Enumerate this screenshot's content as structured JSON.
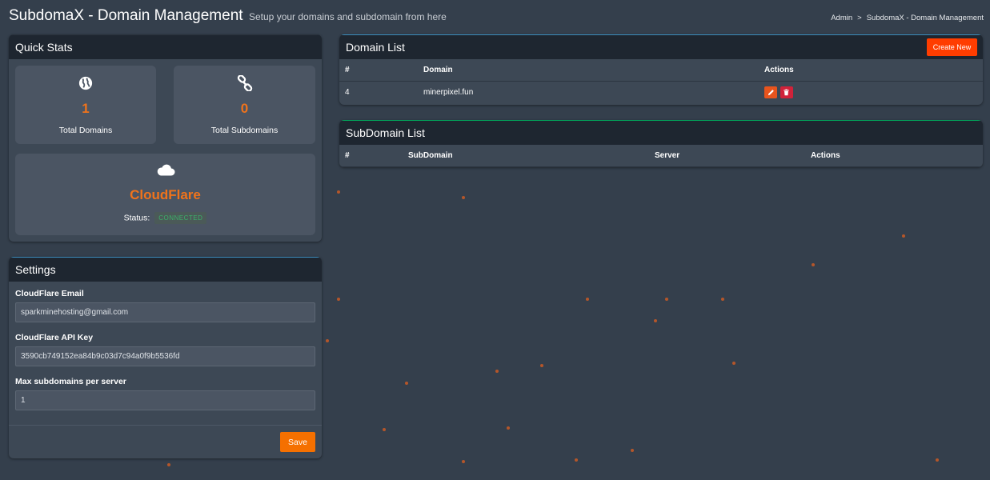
{
  "header": {
    "title": "SubdomaX - Domain Management",
    "subtitle": "Setup your domains and subdomain from here",
    "breadcrumb": [
      "Admin",
      "SubdomaX - Domain Management"
    ],
    "breadcrumb_sep": ">"
  },
  "quick_stats": {
    "title": "Quick Stats",
    "total_domains": {
      "value": "1",
      "label": "Total Domains",
      "icon": "globe-icon"
    },
    "total_subdomains": {
      "value": "0",
      "label": "Total Subdomains",
      "icon": "link-icon"
    },
    "cloudflare": {
      "title": "CloudFlare",
      "status_label": "Status:",
      "status": "CONNECTED",
      "icon": "cloud-icon"
    }
  },
  "settings": {
    "title": "Settings",
    "fields": [
      {
        "label": "CloudFlare Email",
        "value": "sparkminehosting@gmail.com"
      },
      {
        "label": "CloudFlare API Key",
        "value": "3590cb749152ea84b9c03d7c94a0f9b5536fd"
      },
      {
        "label": "Max subdomains per server",
        "value": "1"
      }
    ],
    "save_label": "Save"
  },
  "domain_list": {
    "title": "Domain List",
    "create_label": "Create New",
    "columns": [
      "#",
      "Domain",
      "Actions"
    ],
    "rows": [
      {
        "id": "4",
        "domain": "minerpixel.fun"
      }
    ]
  },
  "subdomain_list": {
    "title": "SubDomain List",
    "columns": [
      "#",
      "SubDomain",
      "Server",
      "Actions"
    ]
  },
  "colors": {
    "background": "#343f4c",
    "accent_orange": "#f0731b",
    "button_orange": "#f57000",
    "create_button": "#ff3d00",
    "badge_green": "#3bb069",
    "delete_red": "#d0223a"
  }
}
